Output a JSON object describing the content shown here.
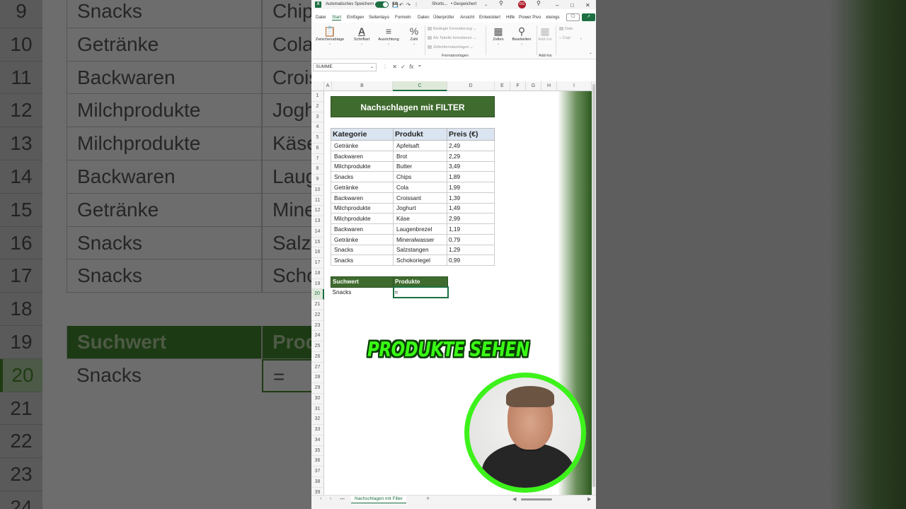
{
  "background_sheet": {
    "rows": [
      {
        "num": "9",
        "category": "Snacks",
        "product": "Chip"
      },
      {
        "num": "10",
        "category": "Getränke",
        "product": "Cola"
      },
      {
        "num": "11",
        "category": "Backwaren",
        "product": "Crois"
      },
      {
        "num": "12",
        "category": "Milchprodukte",
        "product": "Jogh"
      },
      {
        "num": "13",
        "category": "Milchprodukte",
        "product": "Käse"
      },
      {
        "num": "14",
        "category": "Backwaren",
        "product": "Laug"
      },
      {
        "num": "15",
        "category": "Getränke",
        "product": "Mine"
      },
      {
        "num": "16",
        "category": "Snacks",
        "product": "Salz"
      },
      {
        "num": "17",
        "category": "Snacks",
        "product": "Scho"
      },
      {
        "num": "18",
        "category": "",
        "product": ""
      },
      {
        "num": "19",
        "category": "Suchwert",
        "product": "Prod"
      },
      {
        "num": "20",
        "category": "Snacks",
        "product": "="
      },
      {
        "num": "21",
        "category": "",
        "product": ""
      },
      {
        "num": "22",
        "category": "",
        "product": ""
      },
      {
        "num": "23",
        "category": "",
        "product": ""
      },
      {
        "num": "24",
        "category": "",
        "product": ""
      }
    ]
  },
  "titlebar": {
    "autosave_label": "Automatisches Speichern",
    "doc_name": "Shorts...",
    "saved_status": "• Gespeichert",
    "user_initials": "DG"
  },
  "menu": {
    "items": [
      "Datei",
      "Start",
      "Einfügen",
      "Seitenlayo",
      "Formeln",
      "Daten",
      "Überprüfer",
      "Ansicht",
      "Entwicklert",
      "Hilfe",
      "Power Pivo",
      "xteings"
    ],
    "active": "Start"
  },
  "ribbon": {
    "clipboard": "Zwischenablage",
    "font": "Schriftart",
    "alignment": "Ausrichtung",
    "number": "Zahl",
    "cond_format": "Bedingte Formatierung",
    "as_table": "Als Tabelle formatieren",
    "cell_styles": "Zellenformatvorlagen",
    "styles_group": "Formatvorlagen",
    "cells": "Zellen",
    "editing": "Bearbeiten",
    "addins": "Add-Ins",
    "addins_group": "Add-Ins",
    "data": "Date",
    "copilot": "Copi"
  },
  "formula_bar": {
    "name_box": "SUMME",
    "fx": "fx",
    "content": "="
  },
  "columns": [
    "A",
    "B",
    "C",
    "D",
    "E",
    "F",
    "G",
    "H",
    "I"
  ],
  "row_numbers": [
    "1",
    "2",
    "3",
    "4",
    "5",
    "6",
    "7",
    "8",
    "9",
    "10",
    "11",
    "12",
    "13",
    "14",
    "15",
    "16",
    "17",
    "18",
    "19",
    "20",
    "21",
    "22",
    "23",
    "24",
    "25",
    "26",
    "27",
    "28",
    "29",
    "30",
    "31",
    "32",
    "33",
    "34",
    "35",
    "36",
    "37",
    "38",
    "39"
  ],
  "sheet": {
    "title": "Nachschlagen mit FILTER",
    "table_headers": [
      "Kategorie",
      "Produkt",
      "Preis (€)"
    ],
    "table_rows": [
      [
        "Getränke",
        "Apfelsaft",
        "2,49"
      ],
      [
        "Backwaren",
        "Brot",
        "2,29"
      ],
      [
        "Milchprodukte",
        "Butter",
        "3,49"
      ],
      [
        "Snacks",
        "Chips",
        "1,89"
      ],
      [
        "Getränke",
        "Cola",
        "1,99"
      ],
      [
        "Backwaren",
        "Croissant",
        "1,39"
      ],
      [
        "Milchprodukte",
        "Joghurt",
        "1,49"
      ],
      [
        "Milchprodukte",
        "Käse",
        "2,99"
      ],
      [
        "Backwaren",
        "Laugenbrezel",
        "1,19"
      ],
      [
        "Getränke",
        "Mineralwasser",
        "0,79"
      ],
      [
        "Snacks",
        "Salzstangen",
        "1,29"
      ],
      [
        "Snacks",
        "Schokoriegel",
        "0,99"
      ]
    ],
    "lookup_headers": [
      "Suchwert",
      "Produkte"
    ],
    "lookup_value": "Snacks",
    "lookup_formula": "="
  },
  "overlay_caption": "PRODUKTE SEHEN",
  "sheet_tab": "Nachschlagen mit Filter",
  "colors": {
    "excel_green": "#1d6f42",
    "title_green": "#3f6b2f",
    "caption_green": "#39ff14",
    "header_blue": "#dbe5f1"
  }
}
